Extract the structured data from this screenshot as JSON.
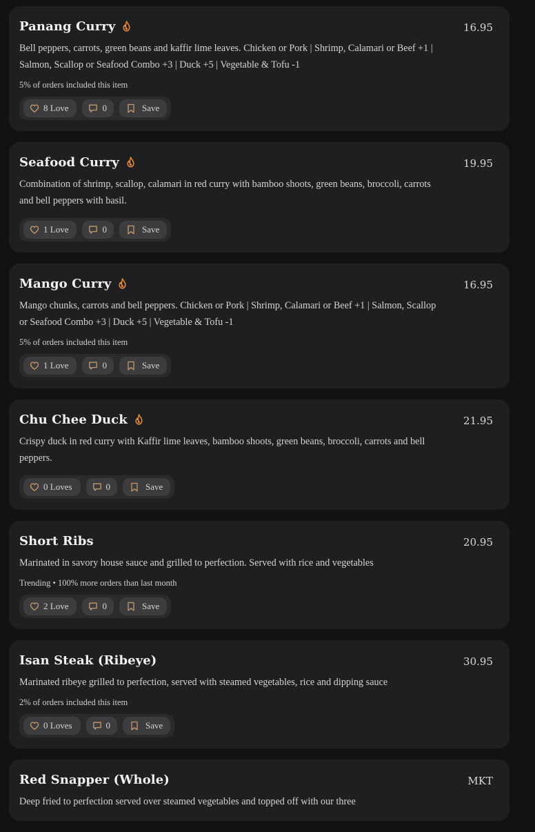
{
  "colors": {
    "background": "#121212",
    "card": "#1f1f21",
    "accent_icon": "#c79a6b",
    "spicy": "#e3873a"
  },
  "items": [
    {
      "name": "Panang Curry",
      "spicy": true,
      "price": "16.95",
      "description": "Bell peppers, carrots, green beans and kaffir lime leaves. Chicken or Pork | Shrimp, Calamari or Beef +1 | Salmon, Scallop or Seafood Combo +3 | Duck +5 | Vegetable & Tofu -1",
      "stat": "5% of orders included this item",
      "love_label": "8 Love",
      "comment_count": "0",
      "save_label": "Save"
    },
    {
      "name": "Seafood Curry",
      "spicy": true,
      "price": "19.95",
      "description": "Combination of shrimp, scallop, calamari in red curry with bamboo shoots, green beans, broccoli, carrots and bell peppers with basil.",
      "stat": "",
      "love_label": "1 Love",
      "comment_count": "0",
      "save_label": "Save"
    },
    {
      "name": "Mango Curry",
      "spicy": true,
      "price": "16.95",
      "description": "Mango chunks, carrots and bell peppers. Chicken or Pork | Shrimp, Calamari or Beef +1 | Salmon, Scallop or Seafood Combo +3 | Duck +5 | Vegetable & Tofu -1",
      "stat": "5% of orders included this item",
      "love_label": "1 Love",
      "comment_count": "0",
      "save_label": "Save"
    },
    {
      "name": "Chu Chee Duck",
      "spicy": true,
      "price": "21.95",
      "description": "Crispy duck in red curry with Kaffir lime leaves, bamboo shoots, green beans, broccoli, carrots and bell peppers.",
      "stat": "",
      "love_label": "0 Loves",
      "comment_count": "0",
      "save_label": "Save"
    },
    {
      "name": "Short Ribs",
      "spicy": false,
      "price": "20.95",
      "description": "Marinated in savory house sauce and grilled to perfection. Served with rice and vegetables",
      "stat": "Trending • 100% more orders than last month",
      "love_label": "2 Love",
      "comment_count": "0",
      "save_label": "Save"
    },
    {
      "name": "Isan Steak (Ribeye)",
      "spicy": false,
      "price": "30.95",
      "description": "Marinated ribeye grilled to perfection, served with steamed vegetables, rice and dipping sauce",
      "stat": "2% of orders included this item",
      "love_label": "0 Loves",
      "comment_count": "0",
      "save_label": "Save"
    },
    {
      "name": "Red Snapper (Whole)",
      "spicy": false,
      "price": "MKT",
      "description": "Deep fried to perfection served over steamed vegetables and topped off with our three",
      "stat": "",
      "love_label": "",
      "comment_count": "",
      "save_label": ""
    }
  ]
}
